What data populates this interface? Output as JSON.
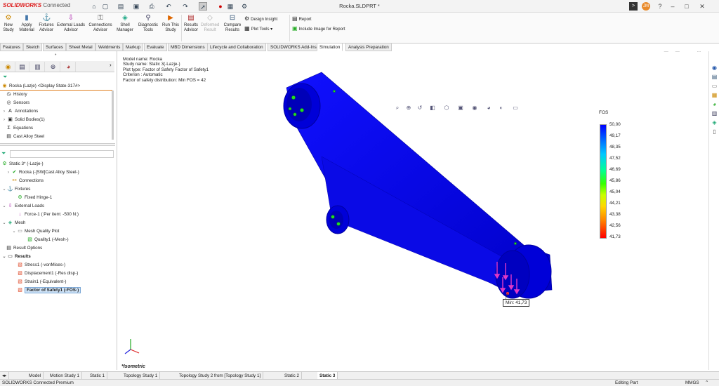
{
  "app": {
    "brand": "SOLIDWORKS",
    "brand_suffix": "Connected",
    "doc_title": "Rocka.SLDPRT *",
    "user_initials": "JM"
  },
  "command_manager": {
    "tools": [
      {
        "label": "New Study",
        "icon": "new-study-icon",
        "name": "new-study-button"
      },
      {
        "label": "Apply Material",
        "icon": "apply-material-icon",
        "name": "apply-material-button"
      },
      {
        "label": "Fixtures Advisor",
        "icon": "fixtures-advisor-icon",
        "name": "fixtures-advisor-button"
      },
      {
        "label": "External Loads Advisor",
        "icon": "external-loads-icon",
        "name": "external-loads-advisor-button"
      },
      {
        "label": "Connections Advisor",
        "icon": "connections-advisor-icon",
        "name": "connections-advisor-button"
      },
      {
        "label": "Shell Manager",
        "icon": "shell-manager-icon",
        "name": "shell-manager-button"
      },
      {
        "label": "Diagnostic Tools",
        "icon": "diagnostic-tools-icon",
        "name": "diagnostic-tools-button"
      },
      {
        "label": "Run This Study",
        "icon": "run-study-icon",
        "name": "run-study-button"
      },
      {
        "label": "Results Advisor",
        "icon": "results-advisor-icon",
        "name": "results-advisor-button"
      },
      {
        "label": "Deformed Result",
        "icon": "deformed-result-icon",
        "name": "deformed-result-button",
        "disabled": true
      },
      {
        "label": "Compare Results",
        "icon": "compare-results-icon",
        "name": "compare-results-button"
      }
    ],
    "small_tools": {
      "design_insight": "Design Insight",
      "plot_tools": "Plot Tools",
      "report": "Report",
      "include_image": "Include Image for Report"
    }
  },
  "tabs": [
    "Features",
    "Sketch",
    "Surfaces",
    "Sheet Metal",
    "Weldments",
    "Markup",
    "Evaluate",
    "MBD Dimensions",
    "Lifecycle and Collaboration",
    "SOLIDWORKS Add-Ins",
    "Simulation",
    "Analysis Preparation"
  ],
  "active_tab": "Simulation",
  "feature_tree": {
    "root": "Rocka (Lazje) <Display State-317#>",
    "items": [
      "History",
      "Sensors",
      "Annotations",
      "Solid Bodies(1)",
      "Equations",
      "Cast Alloy Steel"
    ]
  },
  "study_tree": {
    "filter": "",
    "study": "Static 3* (-Lazje-)",
    "part": "Rocka (-[SW]Cast Alloy Steel-)",
    "connections": "Connections",
    "fixtures": "Fixtures",
    "fixed_hinge": "Fixed Hinge-1",
    "external_loads": "External Loads",
    "force": "Force-1 (:Per item: -500 N:)",
    "mesh": "Mesh",
    "mesh_quality_plot": "Mesh Quality Plot",
    "quality": "Quality1 (-Mesh-)",
    "result_options": "Result Options",
    "results": "Results",
    "result_items": [
      "Stress1 (-vonMises-)",
      "Displacement1 (-Res disp-)",
      "Strain1 (-Equivalent-)",
      "Factor of Safety1 (-FOS-)"
    ]
  },
  "viewport": {
    "info": {
      "model_name": "Model name: Rocka",
      "study_name": "Study name: Static 3(-Lazje-)",
      "plot_type": "Plot type: Factor of Safety Factor of Safety1",
      "criterion": "Criterion : Automatic",
      "distribution": "Factor of safety distribution: Min FOS = 42"
    },
    "legend_title": "FOS",
    "legend_values": [
      "50,00",
      "49,17",
      "48,35",
      "47,52",
      "46,69",
      "45,86",
      "45,04",
      "44,21",
      "43,38",
      "42,56",
      "41,73"
    ],
    "min_label_prefix": "Min:",
    "min_label_value": "41,73",
    "view_label": "*Isometric"
  },
  "bottom_tabs": [
    "Model",
    "Motion Study 1",
    "Static 1",
    "Topology Study 1",
    "Topology Study 2 from [Topology Study 1]",
    "Static 2",
    "Static 3"
  ],
  "active_bottom_tab": "Static 3",
  "status": {
    "left": "SOLIDWORKS Connected Premium",
    "mode": "Editing Part",
    "units": "MMGS"
  }
}
